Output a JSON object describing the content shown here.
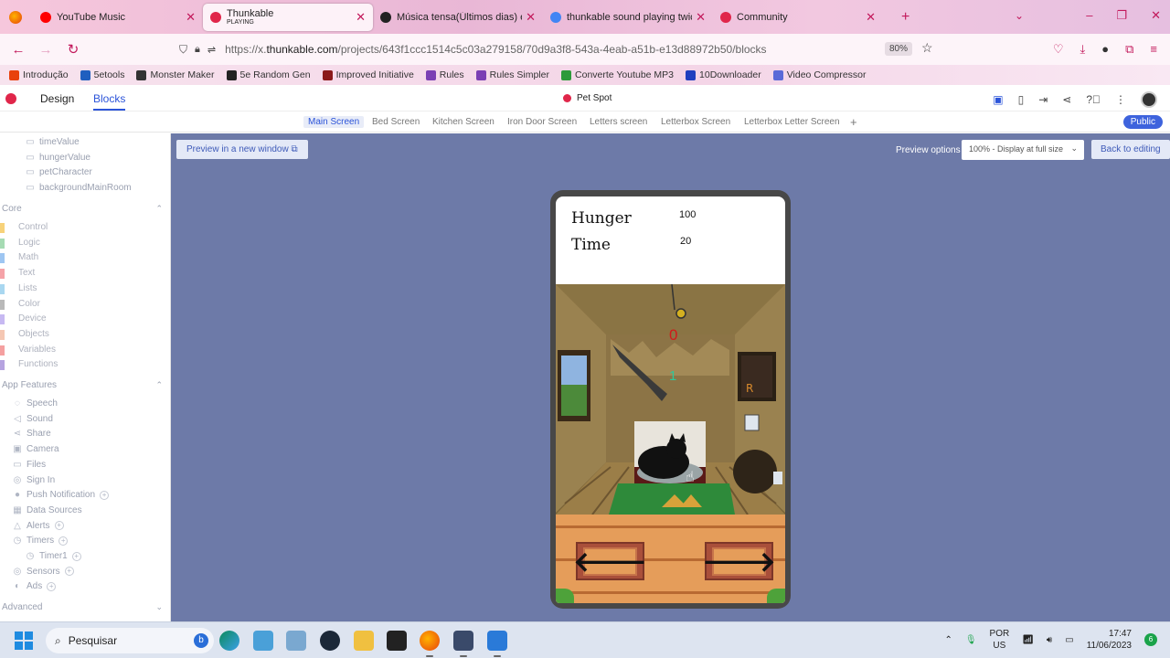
{
  "browser": {
    "tabs": [
      {
        "title": "YouTube Music",
        "sub": "",
        "color": "#ff0000"
      },
      {
        "title": "Thunkable",
        "sub": "PLAYING",
        "color": "#e0264a"
      },
      {
        "title": "Música tensa(Últimos dias) em",
        "sub": "",
        "color": "#222222"
      },
      {
        "title": "thunkable sound playing twice",
        "sub": "",
        "color": "#4285f4"
      },
      {
        "title": "Community",
        "sub": "",
        "color": "#e0264a"
      }
    ],
    "url_prefix": "https://x.",
    "url_domain": "thunkable.com",
    "url_path": "/projects/643f1ccc1514c5c03a279158/70d9a3f8-543a-4eab-a51b-e13d88972b50/blocks",
    "zoom": "80%"
  },
  "bookmarks": [
    {
      "label": "Introdução",
      "color": "#e8410c"
    },
    {
      "label": "5etools",
      "color": "#1f5fbf"
    },
    {
      "label": "Monster Maker",
      "color": "#333333"
    },
    {
      "label": "5e Random Gen",
      "color": "#222222"
    },
    {
      "label": "Improved Initiative",
      "color": "#8b1a1a"
    },
    {
      "label": "Rules",
      "color": "#7b3fb4"
    },
    {
      "label": "Rules Simpler",
      "color": "#7b3fb4"
    },
    {
      "label": "Converte Youtube MP3",
      "color": "#2d9a3a"
    },
    {
      "label": "10Downloader",
      "color": "#1f3fbf"
    },
    {
      "label": "Video Compressor",
      "color": "#5a6ad8"
    }
  ],
  "thunkable": {
    "design_label": "Design",
    "blocks_label": "Blocks",
    "project_name": "Pet Spot",
    "public_label": "Public",
    "screens": [
      "Main Screen",
      "Bed Screen",
      "Kitchen Screen",
      "Iron Door Screen",
      "Letters screen",
      "Letterbox Screen",
      "Letterbox Letter Screen"
    ],
    "active_screen": "Main Screen"
  },
  "sidebar": {
    "variables": [
      "timeValue",
      "hungerValue",
      "petCharacter",
      "backgroundMainRoom"
    ],
    "core_title": "Core",
    "core": [
      {
        "label": "Control",
        "color": "#f7d27a"
      },
      {
        "label": "Logic",
        "color": "#a6dbb3"
      },
      {
        "label": "Math",
        "color": "#9ec6f2"
      },
      {
        "label": "Text",
        "color": "#f5a3a8"
      },
      {
        "label": "Lists",
        "color": "#a9d7f0"
      },
      {
        "label": "Color",
        "color": "#b9b9b9"
      },
      {
        "label": "Device",
        "color": "#c7b9f2"
      },
      {
        "label": "Objects",
        "color": "#f5c7b3"
      },
      {
        "label": "Variables",
        "color": "#f5a0a0"
      },
      {
        "label": "Functions",
        "color": "#b6a3e0"
      }
    ],
    "app_title": "App Features",
    "app_features": [
      {
        "label": "Speech",
        "icon": "speech-icon",
        "glyph": "◌",
        "add": false
      },
      {
        "label": "Sound",
        "icon": "sound-icon",
        "glyph": "◁",
        "add": false
      },
      {
        "label": "Share",
        "icon": "share-icon",
        "glyph": "⋖",
        "add": false
      },
      {
        "label": "Camera",
        "icon": "camera-icon",
        "glyph": "▣",
        "add": false
      },
      {
        "label": "Files",
        "icon": "files-icon",
        "glyph": "▭",
        "add": false
      },
      {
        "label": "Sign In",
        "icon": "sign-in-icon",
        "glyph": "◎",
        "add": false
      },
      {
        "label": "Push Notification",
        "icon": "push-notification-icon",
        "glyph": "●",
        "add": true
      },
      {
        "label": "Data Sources",
        "icon": "data-sources-icon",
        "glyph": "▦",
        "add": false
      },
      {
        "label": "Alerts",
        "icon": "alerts-icon",
        "glyph": "△",
        "add": true
      },
      {
        "label": "Timers",
        "icon": "timers-icon",
        "glyph": "◷",
        "add": true
      },
      {
        "label": "Timer1",
        "icon": "timer-icon",
        "glyph": "◷",
        "add": true,
        "indent": true
      },
      {
        "label": "Sensors",
        "icon": "sensors-icon",
        "glyph": "◎",
        "add": true
      },
      {
        "label": "Ads",
        "icon": "ads-icon",
        "glyph": "◐",
        "add": true
      }
    ],
    "advanced_title": "Advanced"
  },
  "preview": {
    "new_window_label": "Preview in a new window",
    "options_label": "Preview options",
    "zoom_option": "100% - Display at full size",
    "back_label": "Back to editing"
  },
  "app": {
    "hunger_label": "Hunger",
    "hunger_value": "100",
    "time_label": "Time",
    "time_value": "20",
    "counter_red": "0",
    "counter_green": "1",
    "left_arrow": "🡐",
    "right_arrow": "🡒"
  },
  "taskbar": {
    "search_placeholder": "Pesquisar",
    "lang_line1": "POR",
    "lang_line2": "US",
    "time": "17:47",
    "date": "11/06/2023",
    "notif_count": "6"
  }
}
